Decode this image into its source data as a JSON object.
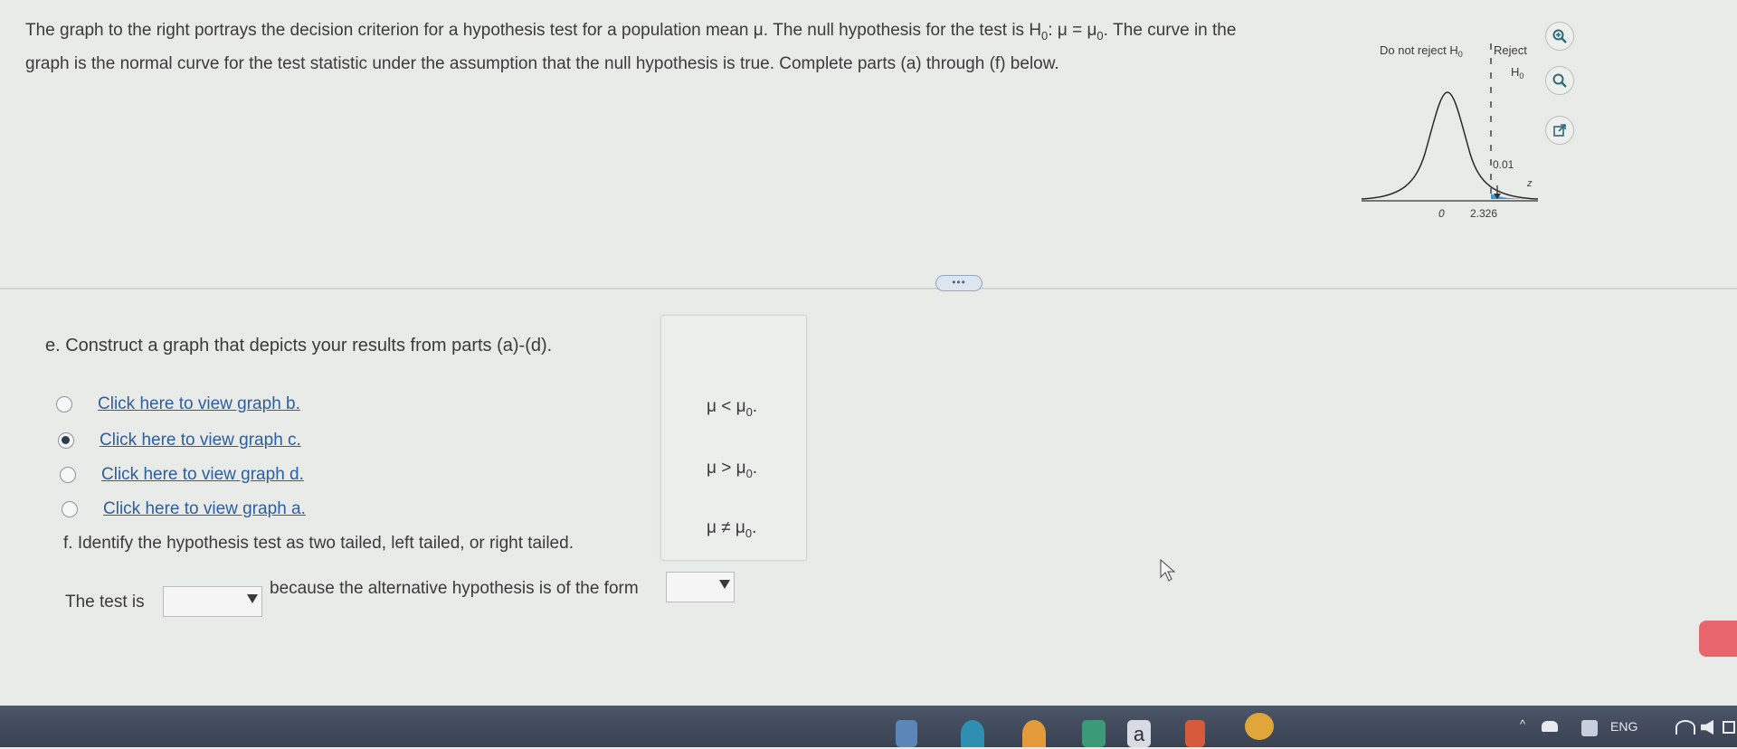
{
  "intro": {
    "line1_a": "The graph to the right portrays the decision criterion for a hypothesis test for a population mean μ. The null hypothesis for the test is H",
    "line1_sub": "0",
    "line1_b": ": μ = μ",
    "line1_sub2": "0",
    "line1_c": ". The curve in the",
    "line2": "graph is the normal curve for the test statistic under the assumption that the null hypothesis is true. Complete parts (a) through (f) below."
  },
  "graph": {
    "label_do_not_reject": "Do not reject H",
    "label_do_not_reject_sub": "0",
    "label_reject": "Reject",
    "label_reject_h": "H",
    "label_reject_h_sub": "0",
    "area": "0.01",
    "axis_var": "z",
    "tick_zero": "0",
    "tick_critical": "2.326"
  },
  "icons": {
    "zoom": "zoom-in-icon",
    "zoom_out": "magnify-icon",
    "popout": "external-link-icon"
  },
  "divider": {
    "label": "•••"
  },
  "part_e": {
    "prompt": "e. Construct a graph that depicts your results from parts (a)-(d).",
    "options": [
      {
        "label": "Click here to view graph b.",
        "selected": false
      },
      {
        "label": "Click here to view graph c.",
        "selected": true
      },
      {
        "label": "Click here to view graph d.",
        "selected": false
      },
      {
        "label": "Click here to view graph a.",
        "selected": false
      }
    ]
  },
  "popup": {
    "items": [
      {
        "a": "μ < μ",
        "sub": "0",
        "b": "."
      },
      {
        "a": "μ > μ",
        "sub": "0",
        "b": "."
      },
      {
        "a": "μ ≠ μ",
        "sub": "0",
        "b": "."
      }
    ]
  },
  "part_f": {
    "prompt": "f. Identify the hypothesis test as two tailed, left tailed, or right tailed.",
    "lead": "The test is",
    "middle": "because the alternative hypothesis is of the form",
    "dropdown1_value": "",
    "dropdown2_value": ""
  },
  "taskbar": {
    "app_letter": "a",
    "tray_lang": "ENG"
  },
  "colors": {
    "background": "#e9ebe8",
    "link": "#2e5ea0",
    "taskbar": "#3f4859",
    "accent_red": "#e8666e"
  }
}
